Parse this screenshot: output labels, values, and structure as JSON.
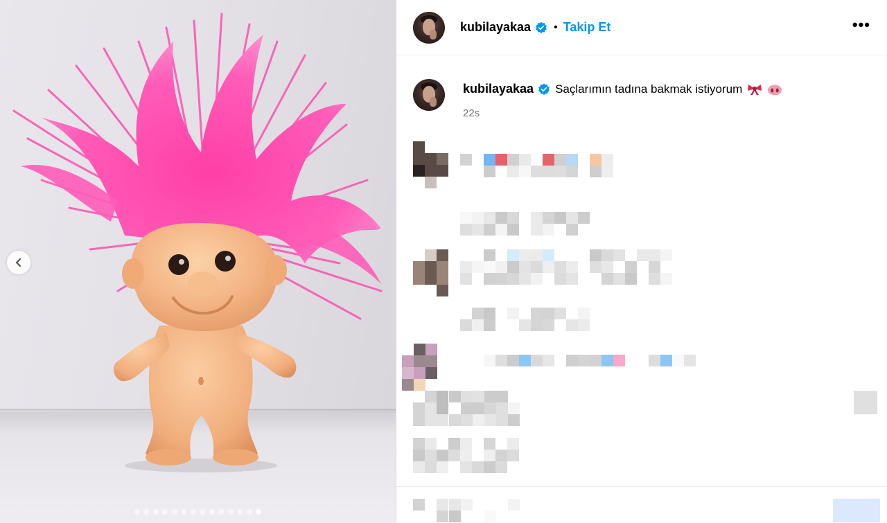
{
  "post": {
    "author": {
      "username": "kubilayakaa",
      "verified": true,
      "follow_label": "Takip Et",
      "bullet": "•",
      "more_label": "•••"
    },
    "caption": {
      "username": "kubilayakaa",
      "text": "Saçlarımın tadına bakmak istiyorum",
      "emojis": [
        "ribbon-emoji",
        "pig-nose-emoji"
      ],
      "time": "22s"
    },
    "carousel": {
      "total_slides": 14,
      "active_slide": 14,
      "prev_icon": "chevron-left-icon"
    },
    "comments_censored": true
  },
  "colors": {
    "accent": "#0095f6",
    "verified_badge": "#0095f6",
    "troll_hair": "#ff4fb0",
    "troll_skin": "#f5b98c",
    "muted_text": "#737373"
  }
}
